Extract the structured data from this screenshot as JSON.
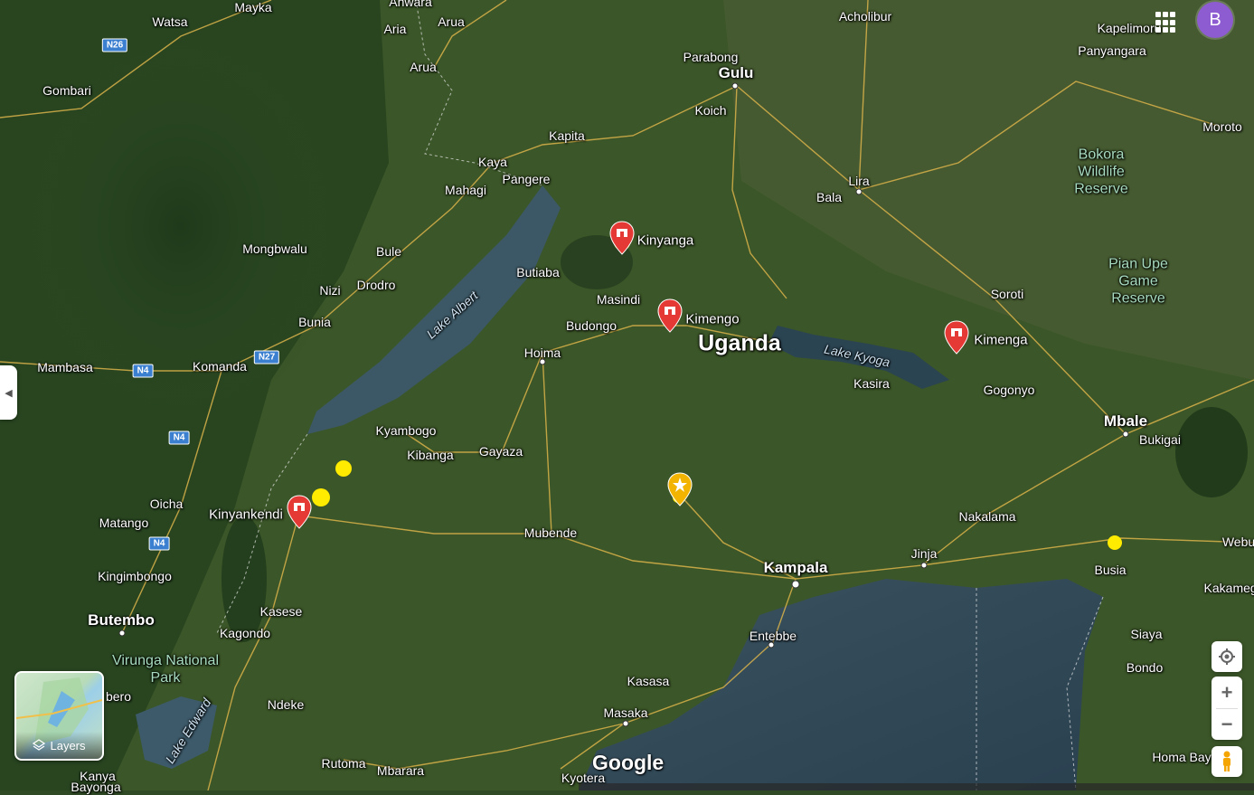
{
  "map": {
    "country_label": "Uganda",
    "cities_major": [
      {
        "name": "Gulu"
      },
      {
        "name": "Kampala"
      },
      {
        "name": "Mbale"
      },
      {
        "name": "Butembo"
      }
    ],
    "places": [
      "Watsa",
      "Mayka",
      "Anwara",
      "Arua",
      "Aria",
      "Arua",
      "Acholibur",
      "Kapelimoru",
      "Panyangara",
      "Parabong",
      "Gombari",
      "Koich",
      "Moroto",
      "Kapita",
      "Kaya",
      "Pangere",
      "Mahagi",
      "Lira",
      "Bala",
      "Mongbwalu",
      "Bule",
      "Butiaba",
      "Nizi",
      "Drodro",
      "Masindi",
      "Budongo",
      "Bunia",
      "Soroti",
      "Mambasa",
      "Komanda",
      "Hoima",
      "Kasira",
      "Gogonyo",
      "Kyambogo",
      "Kibanga",
      "Gayaza",
      "Bukigai",
      "Oicha",
      "Matango",
      "Mubende",
      "Nakalama",
      "Webu",
      "Kingimbongo",
      "Jinja",
      "Kasese",
      "Busia",
      "Kagondo",
      "Entebbe",
      "Kakamega",
      "Siaya",
      "Bondo",
      "Kasasa",
      "Ndeke",
      "Masaka",
      "Rutoma",
      "Mbarara",
      "Kyotera",
      "Homa Bay",
      "Kanya",
      "Bayonga",
      "bero"
    ],
    "parks": [
      "Bokora Wildlife Reserve",
      "Pian Upe Game Reserve",
      "Virunga National Park"
    ],
    "waters": [
      "Lake Albert",
      "Lake Kyoga",
      "Lake Edward"
    ],
    "routes": [
      "N26",
      "N4",
      "N27",
      "N4",
      "N4"
    ],
    "markers": [
      {
        "label": "Kinyanga",
        "icon": "hotel-pin-icon",
        "color": "#e53935"
      },
      {
        "label": "Kimengo",
        "icon": "hotel-pin-icon",
        "color": "#e53935"
      },
      {
        "label": "Kimenga",
        "icon": "hotel-pin-icon",
        "color": "#e53935"
      },
      {
        "label": "Kinyankendi",
        "icon": "hotel-pin-icon",
        "color": "#e53935"
      },
      {
        "label": "",
        "icon": "starred-pin-icon",
        "color": "#f2b400"
      }
    ],
    "highlight_color": "#ffeb00"
  },
  "controls": {
    "layers_label": "Layers",
    "account_initial": "B",
    "brand": "Google",
    "zoom_in": "+",
    "zoom_out": "−"
  }
}
